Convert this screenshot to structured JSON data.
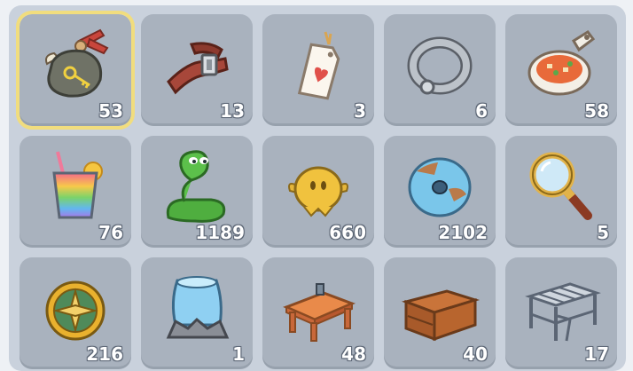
{
  "inventory": {
    "slots": [
      {
        "icon": "pouch-with-key-icon",
        "count": "53",
        "selected": true
      },
      {
        "icon": "leather-belt-icon",
        "count": "13"
      },
      {
        "icon": "heart-card-tag-icon",
        "count": "3"
      },
      {
        "icon": "metal-ring-icon",
        "count": "6"
      },
      {
        "icon": "soup-bowl-icon",
        "count": "58"
      },
      {
        "icon": "rainbow-juice-icon",
        "count": "76"
      },
      {
        "icon": "green-snake-icon",
        "count": "1189"
      },
      {
        "icon": "golden-blob-icon",
        "count": "660"
      },
      {
        "icon": "blue-disc-icon",
        "count": "2102"
      },
      {
        "icon": "magnifying-glass-icon",
        "count": "5"
      },
      {
        "icon": "compass-coin-icon",
        "count": "216"
      },
      {
        "icon": "ice-crystal-rock-icon",
        "count": "1"
      },
      {
        "icon": "wooden-table-icon",
        "count": "48"
      },
      {
        "icon": "wooden-chest-icon",
        "count": "40"
      },
      {
        "icon": "metal-rack-icon",
        "count": "17"
      }
    ]
  },
  "colors": {
    "selected_outline": "#f1dd7e",
    "slot_bg": "#a9b2be",
    "panel_bg": "#c9d1dc"
  }
}
